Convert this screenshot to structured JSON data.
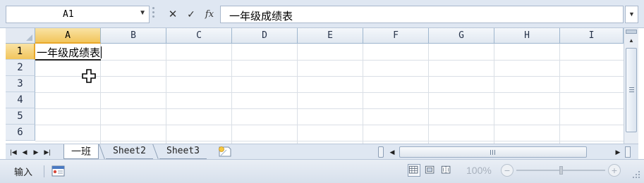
{
  "formula_bar": {
    "name_box": "A1",
    "cancel_icon": "✕",
    "enter_icon": "✓",
    "fx_label": "fx",
    "content": "一年级成绩表",
    "expand_icon": "chevron-down-icon"
  },
  "grid": {
    "columns": [
      "A",
      "B",
      "C",
      "D",
      "E",
      "F",
      "G",
      "H",
      "I"
    ],
    "rows": [
      "1",
      "2",
      "3",
      "4",
      "5",
      "6"
    ],
    "selected_column": "A",
    "selected_row": "1",
    "cells": {
      "A1": "一年级成绩表"
    }
  },
  "sheet_tabs": {
    "tabs": [
      "一班",
      "Sheet2",
      "Sheet3"
    ],
    "active": "一班",
    "nav_icons": [
      "first-sheet-icon",
      "prev-sheet-icon",
      "next-sheet-icon",
      "last-sheet-icon"
    ]
  },
  "status_bar": {
    "mode": "输入",
    "zoom": "100%",
    "minus": "−",
    "plus": "+"
  },
  "colors": {
    "chrome": "#dfe7f2",
    "header_selected": "#f2c55c",
    "gridline": "#dadfe6",
    "header_border": "#9eb6ce"
  }
}
